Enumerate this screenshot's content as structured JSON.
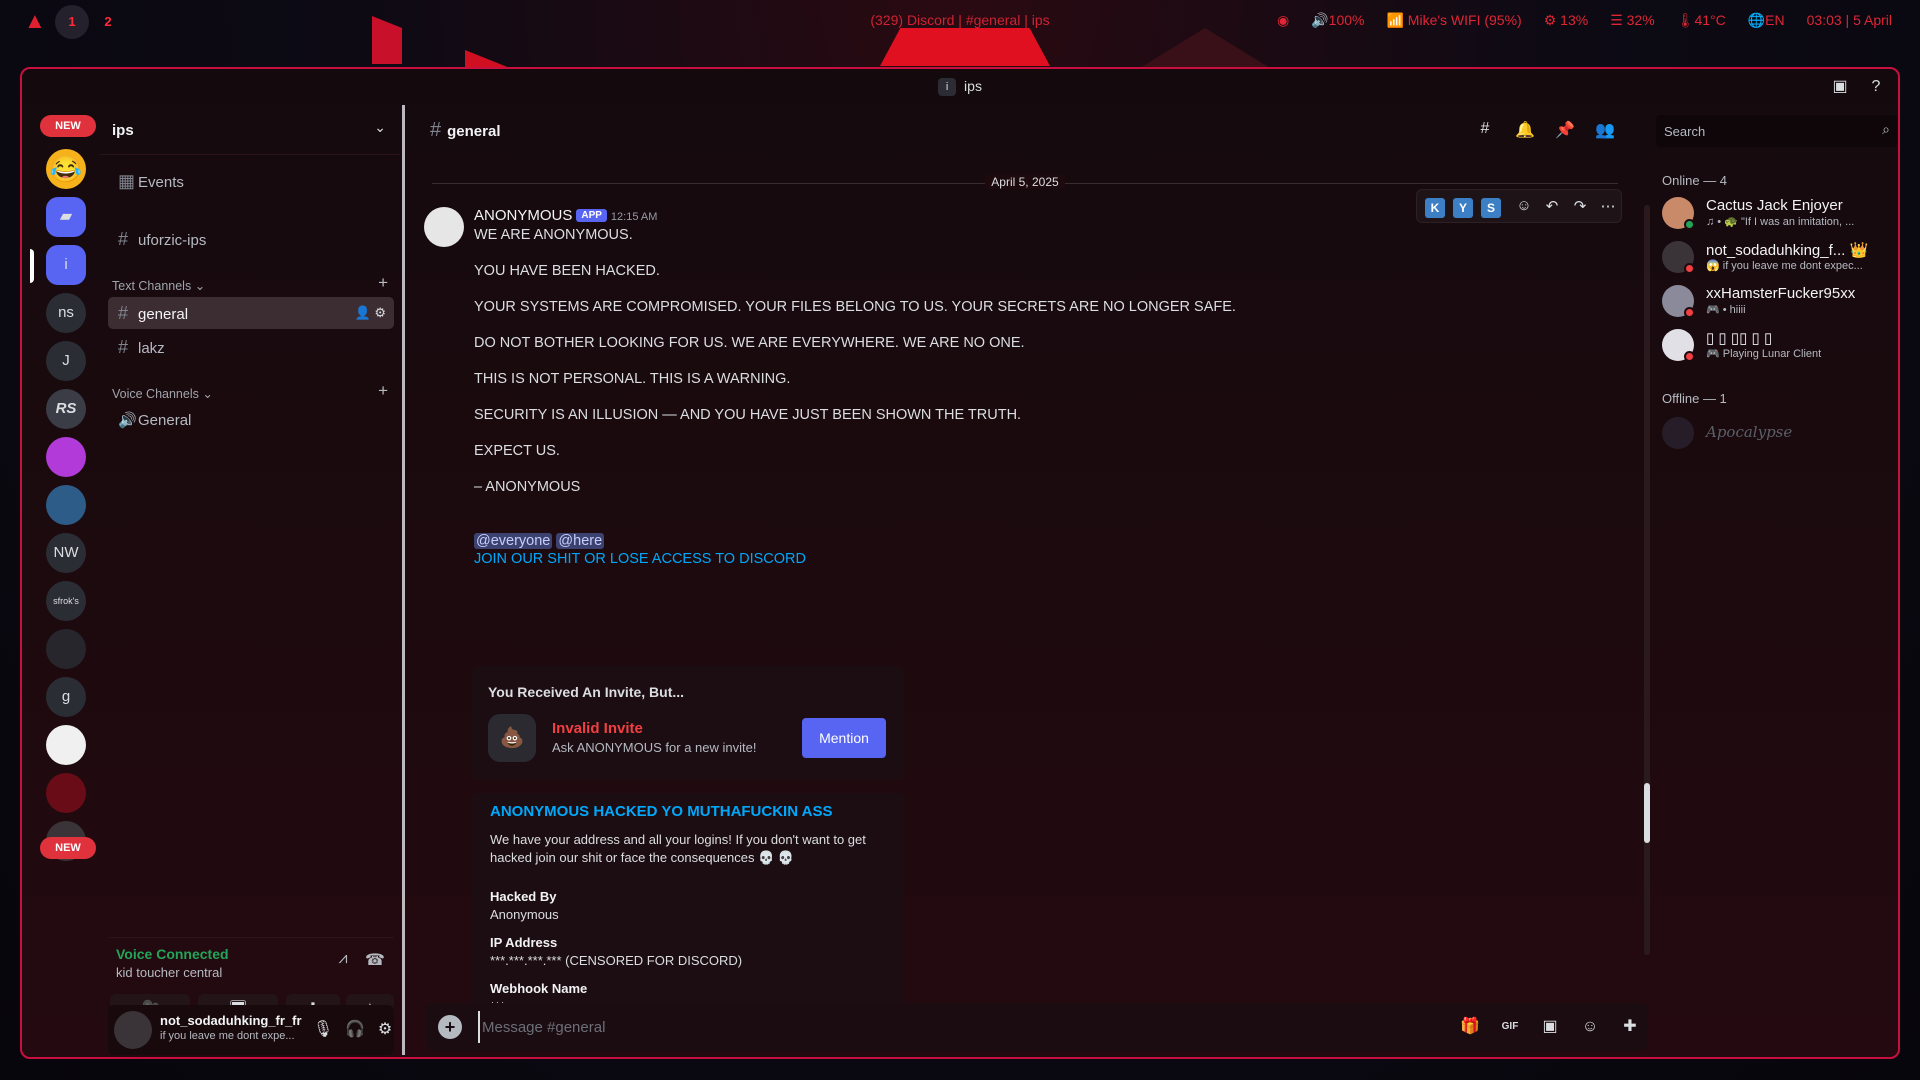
{
  "topbar": {
    "workspaces": [
      "1",
      "2"
    ],
    "window_title": "(329) Discord | #general | ips",
    "status": [
      "100%",
      "Mike's WIFI (95%)",
      "13%",
      "32%",
      "41°C",
      "EN",
      "03:03 | 5 April"
    ]
  },
  "titlebar": {
    "server_initial": "i",
    "server_name": "ips"
  },
  "rail": {
    "new_label": "NEW",
    "guilds": [
      "i",
      "ns",
      "J",
      "RS",
      "NW",
      "sfrok's",
      "g"
    ]
  },
  "sidebar": {
    "server_name": "ips",
    "events": "Events",
    "top_channel": "uforzic-ips",
    "text_category": "Text Channels",
    "text_channels": [
      "general",
      "lakz"
    ],
    "voice_category": "Voice Channels",
    "voice_channels": [
      "General"
    ]
  },
  "voice": {
    "status": "Voice Connected",
    "channel": "kid toucher central"
  },
  "user": {
    "name": "not_sodaduhking_fr_fr",
    "status": "if you leave me dont expe..."
  },
  "chat": {
    "channel": "general",
    "date": "April 5, 2025",
    "message": {
      "author": "ANONYMOUS",
      "tag": "APP",
      "time": "12:15 AM",
      "lines": [
        "WE ARE ANONYMOUS.",
        "YOU HAVE BEEN HACKED.",
        "YOUR SYSTEMS ARE COMPROMISED. YOUR FILES BELONG TO US. YOUR SECRETS ARE NO LONGER SAFE.",
        "DO NOT BOTHER LOOKING FOR US. WE ARE EVERYWHERE. WE ARE NO ONE.",
        "THIS IS NOT PERSONAL. THIS IS A WARNING.",
        "SECURITY IS AN ILLUSION — AND YOU HAVE JUST BEEN SHOWN THE TRUTH.",
        "EXPECT US.",
        "– ANONYMOUS"
      ],
      "mention_everyone": "@everyone",
      "mention_here": "@here",
      "link": "JOIN OUR SHIT OR LOSE ACCESS TO DISCORD"
    },
    "hover_keys": [
      "K",
      "Y",
      "S"
    ],
    "invite": {
      "title": "You Received An Invite, But...",
      "heading": "Invalid Invite",
      "sub": "Ask ANONYMOUS for a new invite!",
      "button": "Mention"
    },
    "embed": {
      "title": "ANONYMOUS HACKED YO MUTHAFUCKIN ASS",
      "desc": "We have your address and all your logins! If you don't want to get hacked join our shit or face the consequences 💀 💀",
      "fields": [
        {
          "name": "Hacked By",
          "value": "Anonymous"
        },
        {
          "name": "IP Address",
          "value": "***.***.***.*** (CENSORED FOR DISCORD)"
        },
        {
          "name": "Webhook Name",
          "value": "***"
        }
      ]
    },
    "composer_placeholder": "Message #general"
  },
  "members": {
    "search_placeholder": "Search",
    "online_label": "Online — 4",
    "online": [
      {
        "name": "Cactus Jack Enjoyer",
        "activity": "♫ • 🐢 \"If I was an imitation, ...",
        "status_color": "#23a559"
      },
      {
        "name": "not_sodaduhking_f... 👑",
        "activity": "😱 if you leave me dont expec...",
        "status_color": "#f23f43"
      },
      {
        "name": "xxHamsterFucker95xx",
        "activity": "🎮 • hiiii",
        "status_color": "#f23f43"
      },
      {
        "name": "▯ ▯ ▯▯ ▯ ▯",
        "activity": "🎮 Playing Lunar Client",
        "status_color": "#f23f43"
      }
    ],
    "offline_label": "Offline — 1",
    "offline": [
      {
        "name": "Apocalypse"
      }
    ]
  }
}
